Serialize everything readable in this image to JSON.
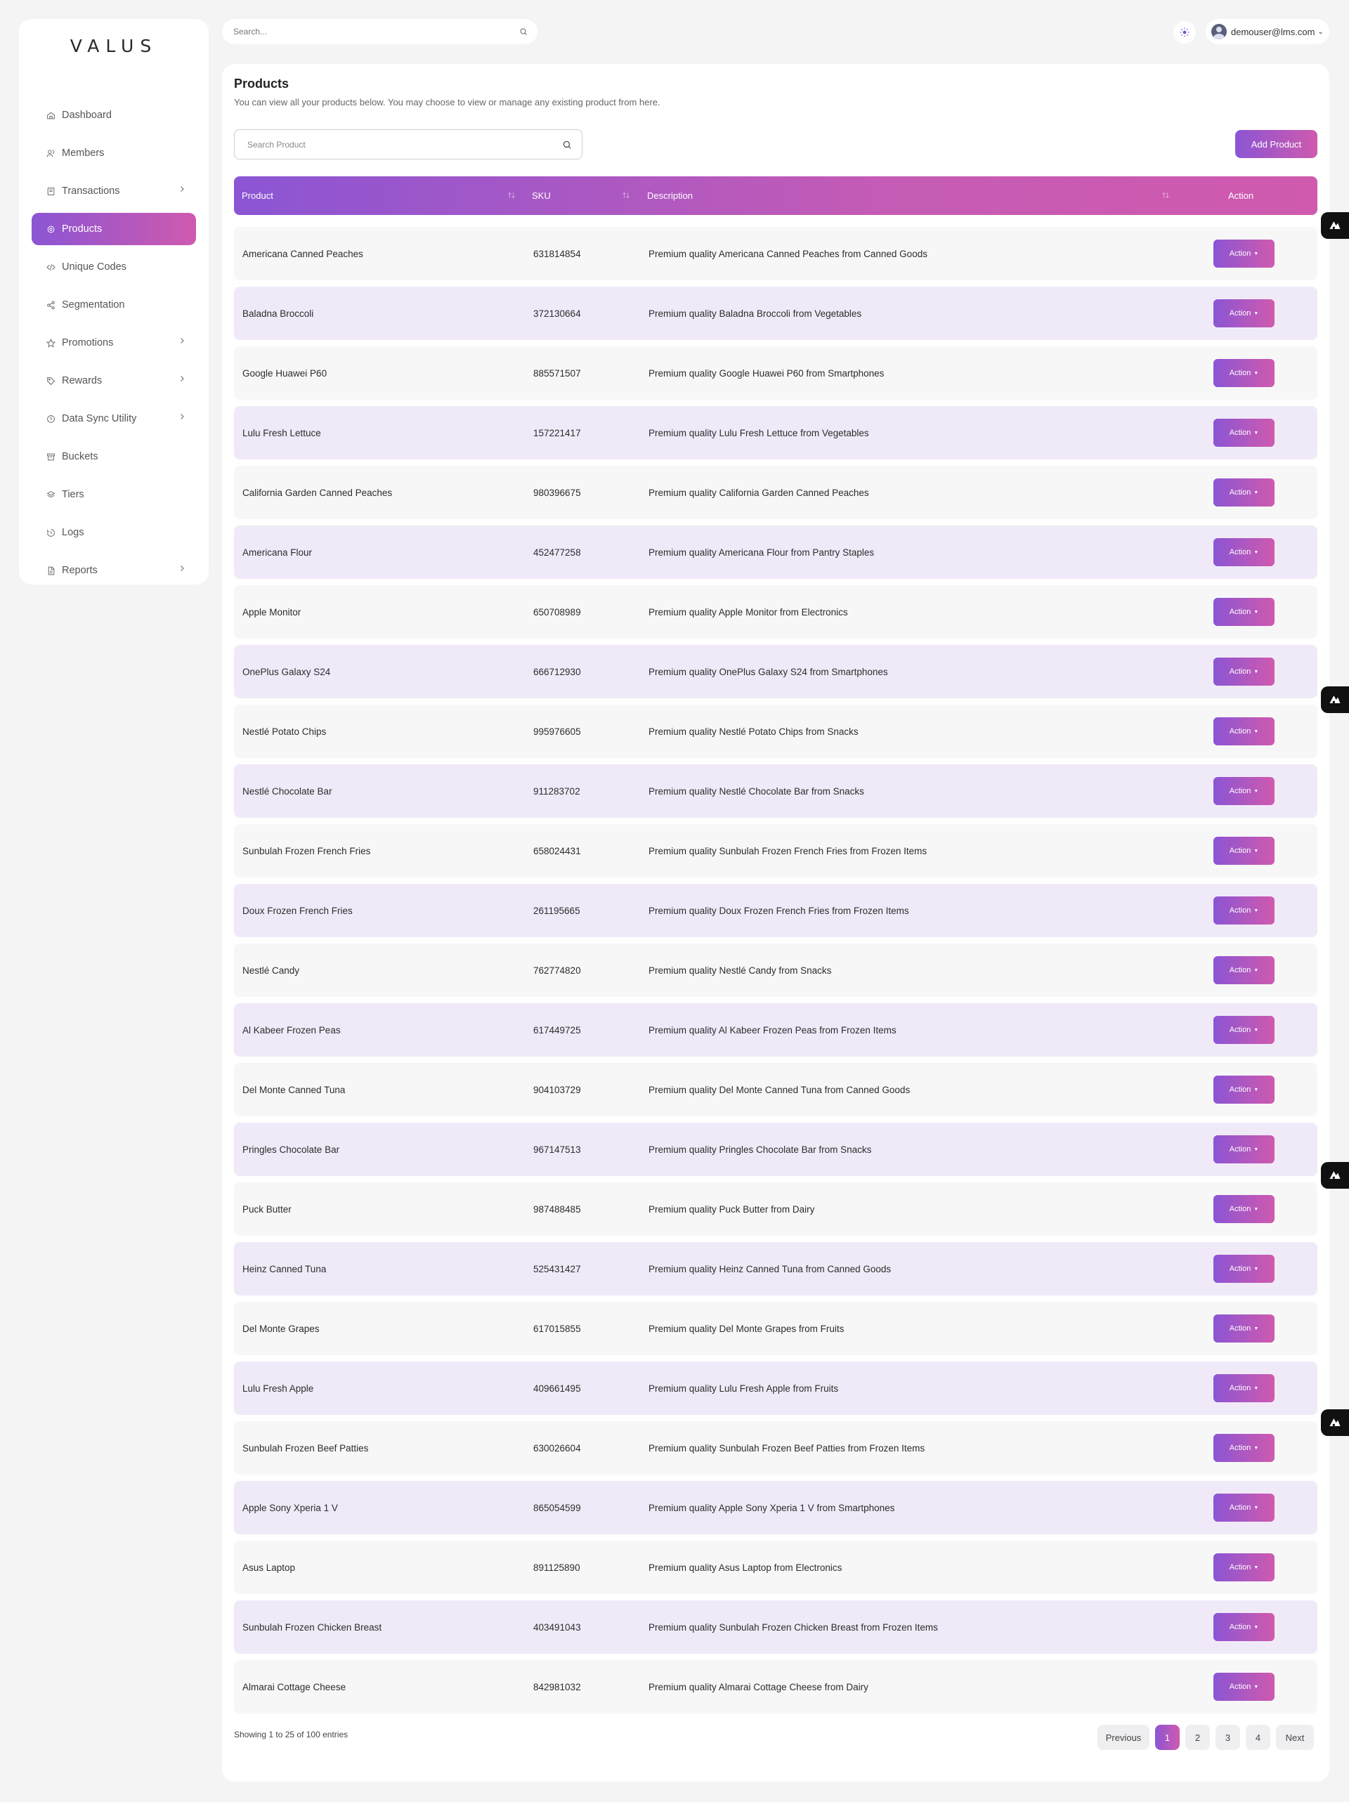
{
  "brand": "VALUS",
  "top_search": {
    "placeholder": "Search..."
  },
  "user": {
    "email": "demouser@lms.com"
  },
  "sidebar": {
    "items": [
      {
        "label": "Dashboard",
        "icon": "home-icon",
        "chevron": false,
        "active": false
      },
      {
        "label": "Members",
        "icon": "users-icon",
        "chevron": false,
        "active": false
      },
      {
        "label": "Transactions",
        "icon": "receipt-icon",
        "chevron": true,
        "active": false
      },
      {
        "label": "Products",
        "icon": "gear-icon",
        "chevron": false,
        "active": true
      },
      {
        "label": "Unique Codes",
        "icon": "code-icon",
        "chevron": false,
        "active": false
      },
      {
        "label": "Segmentation",
        "icon": "share-icon",
        "chevron": false,
        "active": false
      },
      {
        "label": "Promotions",
        "icon": "star-icon",
        "chevron": true,
        "active": false
      },
      {
        "label": "Rewards",
        "icon": "tag-icon",
        "chevron": true,
        "active": false
      },
      {
        "label": "Data Sync Utility",
        "icon": "sync-icon",
        "chevron": true,
        "active": false
      },
      {
        "label": "Buckets",
        "icon": "archive-icon",
        "chevron": false,
        "active": false
      },
      {
        "label": "Tiers",
        "icon": "layers-icon",
        "chevron": false,
        "active": false
      },
      {
        "label": "Logs",
        "icon": "history-icon",
        "chevron": false,
        "active": false
      },
      {
        "label": "Reports",
        "icon": "file-icon",
        "chevron": true,
        "active": false
      }
    ]
  },
  "main": {
    "title": "Products",
    "subtitle": "You can view all your products below. You may choose to view or manage any existing product from here.",
    "search_placeholder": "Search Product",
    "add_label": "Add Product",
    "columns": {
      "product": "Product",
      "sku": "SKU",
      "description": "Description",
      "action": "Action"
    },
    "action_label": "Action",
    "rows": [
      {
        "product": "Americana Canned Peaches",
        "sku": "631814854",
        "description": "Premium quality Americana Canned Peaches from Canned Goods"
      },
      {
        "product": "Baladna Broccoli",
        "sku": "372130664",
        "description": "Premium quality Baladna Broccoli from Vegetables"
      },
      {
        "product": "Google Huawei P60",
        "sku": "885571507",
        "description": "Premium quality Google Huawei P60 from Smartphones"
      },
      {
        "product": "Lulu Fresh Lettuce",
        "sku": "157221417",
        "description": "Premium quality Lulu Fresh Lettuce from Vegetables"
      },
      {
        "product": "California Garden Canned Peaches",
        "sku": "980396675",
        "description": "Premium quality California Garden Canned Peaches"
      },
      {
        "product": "Americana Flour",
        "sku": "452477258",
        "description": "Premium quality Americana Flour from Pantry Staples"
      },
      {
        "product": "Apple Monitor",
        "sku": "650708989",
        "description": "Premium quality Apple Monitor from Electronics"
      },
      {
        "product": "OnePlus Galaxy S24",
        "sku": "666712930",
        "description": "Premium quality OnePlus Galaxy S24 from Smartphones"
      },
      {
        "product": "Nestlé Potato Chips",
        "sku": "995976605",
        "description": "Premium quality Nestlé Potato Chips from Snacks"
      },
      {
        "product": "Nestlé Chocolate Bar",
        "sku": "911283702",
        "description": "Premium quality Nestlé Chocolate Bar from Snacks"
      },
      {
        "product": "Sunbulah Frozen French Fries",
        "sku": "658024431",
        "description": "Premium quality Sunbulah Frozen French Fries from Frozen Items"
      },
      {
        "product": "Doux Frozen French Fries",
        "sku": "261195665",
        "description": "Premium quality Doux Frozen French Fries from Frozen Items"
      },
      {
        "product": "Nestlé Candy",
        "sku": "762774820",
        "description": "Premium quality Nestlé Candy from Snacks"
      },
      {
        "product": "Al Kabeer Frozen Peas",
        "sku": "617449725",
        "description": "Premium quality Al Kabeer Frozen Peas from Frozen Items"
      },
      {
        "product": "Del Monte Canned Tuna",
        "sku": "904103729",
        "description": "Premium quality Del Monte Canned Tuna from Canned Goods"
      },
      {
        "product": "Pringles Chocolate Bar",
        "sku": "967147513",
        "description": "Premium quality Pringles Chocolate Bar from Snacks"
      },
      {
        "product": "Puck Butter",
        "sku": "987488485",
        "description": "Premium quality Puck Butter from Dairy"
      },
      {
        "product": "Heinz Canned Tuna",
        "sku": "525431427",
        "description": "Premium quality Heinz Canned Tuna from Canned Goods"
      },
      {
        "product": "Del Monte Grapes",
        "sku": "617015855",
        "description": "Premium quality Del Monte Grapes from Fruits"
      },
      {
        "product": "Lulu Fresh Apple",
        "sku": "409661495",
        "description": "Premium quality Lulu Fresh Apple from Fruits"
      },
      {
        "product": "Sunbulah Frozen Beef Patties",
        "sku": "630026604",
        "description": "Premium quality Sunbulah Frozen Beef Patties from Frozen Items"
      },
      {
        "product": "Apple Sony Xperia 1 V",
        "sku": "865054599",
        "description": "Premium quality Apple Sony Xperia 1 V from Smartphones"
      },
      {
        "product": "Asus Laptop",
        "sku": "891125890",
        "description": "Premium quality Asus Laptop from Electronics"
      },
      {
        "product": "Sunbulah Frozen Chicken Breast",
        "sku": "403491043",
        "description": "Premium quality Sunbulah Frozen Chicken Breast from Frozen Items"
      },
      {
        "product": "Almarai Cottage Cheese",
        "sku": "842981032",
        "description": "Premium quality Almarai Cottage Cheese from Dairy"
      }
    ],
    "showing_text": "Showing 1 to 25 of 100 entries",
    "pagination": {
      "previous": "Previous",
      "pages": [
        "1",
        "2",
        "3",
        "4"
      ],
      "current": "1",
      "next": "Next"
    }
  },
  "colors": {
    "accent_start": "#8b55d4",
    "accent_end": "#cf5aae",
    "row_alt": "#f0eaf8",
    "row": "#f7f7f8"
  }
}
